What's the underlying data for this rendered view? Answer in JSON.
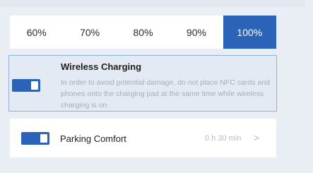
{
  "header": {
    "faded_text": ""
  },
  "charge_limit": {
    "options": [
      "60%",
      "70%",
      "80%",
      "90%",
      "100%"
    ],
    "selected": "100%"
  },
  "wireless_charging": {
    "title": "Wireless Charging",
    "description": "In order to avoid potential damage, do not place NFC cards and phones onto the charging pad at the same time while wireless charging is on",
    "enabled": true
  },
  "parking_comfort": {
    "title": "Parking Comfort",
    "value": "0 h 30 min",
    "enabled": true,
    "chevron": "chevron-right-icon"
  },
  "colors": {
    "accent": "#2a63b7",
    "background": "#e9edf4",
    "card": "#ffffff",
    "selected_card_border": "#8fb0de",
    "muted_text": "#a7adb8"
  }
}
